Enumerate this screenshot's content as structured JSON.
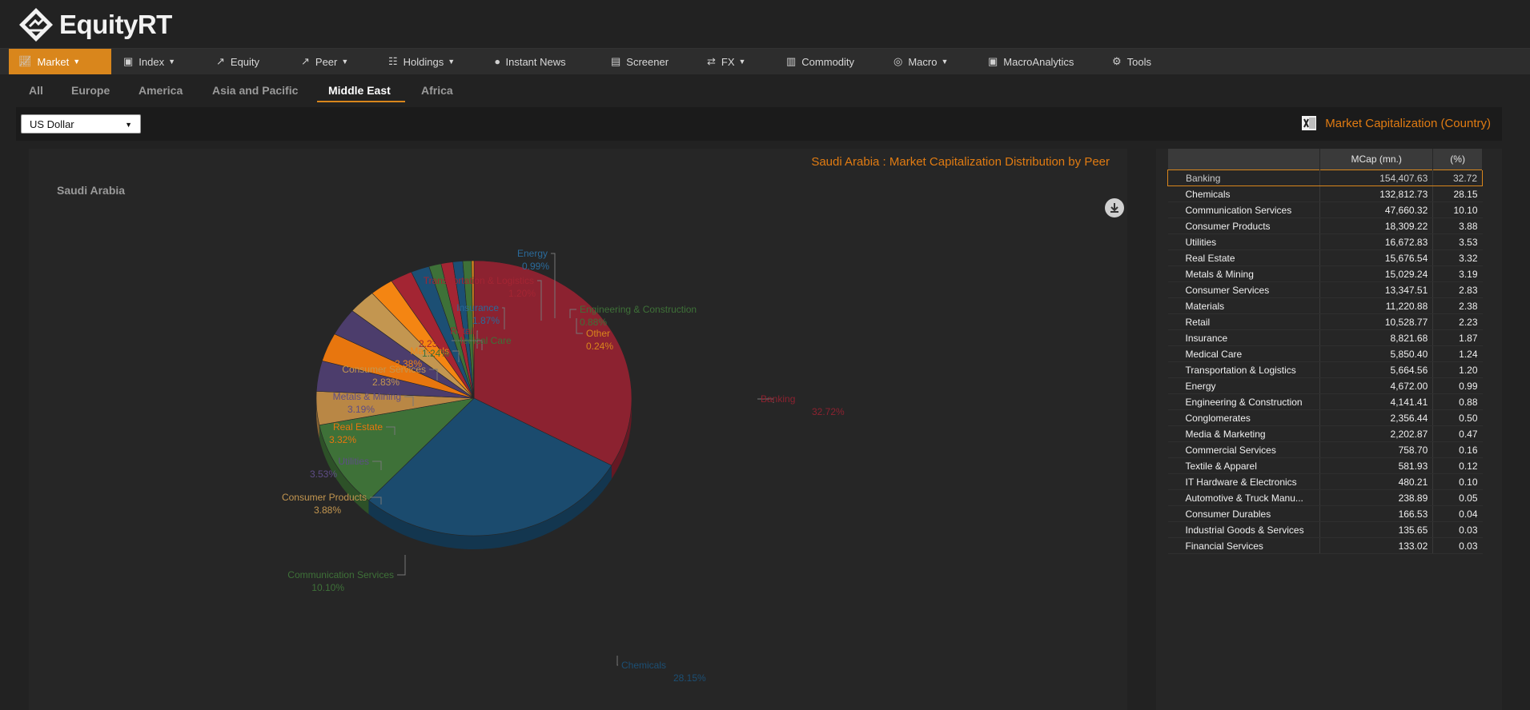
{
  "app": {
    "name": "EquityRT"
  },
  "nav": [
    {
      "label": "Market",
      "icon": "market-chart-icon",
      "dropdown": true,
      "active": true
    },
    {
      "label": "Index",
      "icon": "monitor-icon",
      "dropdown": true
    },
    {
      "label": "Equity",
      "icon": "line-chart-icon",
      "dropdown": false
    },
    {
      "label": "Peer",
      "icon": "peer-chart-icon",
      "dropdown": true
    },
    {
      "label": "Holdings",
      "icon": "holdings-icon",
      "dropdown": true
    },
    {
      "label": "Instant News",
      "icon": "news-broadcast-icon",
      "dropdown": false
    },
    {
      "label": "Screener",
      "icon": "screener-icon",
      "dropdown": false
    },
    {
      "label": "FX",
      "icon": "fx-icon",
      "dropdown": true
    },
    {
      "label": "Commodity",
      "icon": "document-icon",
      "dropdown": false
    },
    {
      "label": "Macro",
      "icon": "globe-icon",
      "dropdown": true
    },
    {
      "label": "MacroAnalytics",
      "icon": "analytics-monitor-icon",
      "dropdown": false
    },
    {
      "label": "Tools",
      "icon": "gears-icon",
      "dropdown": false
    }
  ],
  "regions": [
    {
      "label": "All",
      "active": false
    },
    {
      "label": "Europe",
      "active": false
    },
    {
      "label": "America",
      "active": false
    },
    {
      "label": "Asia and Pacific",
      "active": false
    },
    {
      "label": "Middle East",
      "active": true
    },
    {
      "label": "Africa",
      "active": false
    }
  ],
  "toolbar": {
    "currency": "US Dollar",
    "export_label": "Market Capitalization (Country)"
  },
  "chart_data": {
    "type": "pie",
    "title": "Saudi Arabia : Market Capitalization Distribution by Peer",
    "subtitle": "Saudi Arabia",
    "slices": [
      {
        "label": "Banking",
        "value": 32.72,
        "color": "#8c2230"
      },
      {
        "label": "Chemicals",
        "value": 28.15,
        "color": "#1b4b6e"
      },
      {
        "label": "Communication Services",
        "value": 10.1,
        "color": "#3e7138"
      },
      {
        "label": "Consumer Products",
        "value": 3.88,
        "color": "#b98745"
      },
      {
        "label": "Utilities",
        "value": 3.53,
        "color": "#4c3d6c"
      },
      {
        "label": "Real Estate",
        "value": 3.32,
        "color": "#e8760e"
      },
      {
        "label": "Metals & Mining",
        "value": 3.19,
        "color": "#4c3d6c"
      },
      {
        "label": "Consumer Services",
        "value": 2.83,
        "color": "#c39650"
      },
      {
        "label": "Materials",
        "value": 2.38,
        "color": "#f48512"
      },
      {
        "label": "Retail",
        "value": 2.23,
        "color": "#a32533"
      },
      {
        "label": "Insurance",
        "value": 1.87,
        "color": "#1c4f74"
      },
      {
        "label": "Medical Care",
        "value": 1.24,
        "color": "#3e7138"
      },
      {
        "label": "Transportation & Logistics",
        "value": 1.2,
        "color": "#a32533"
      },
      {
        "label": "Energy",
        "value": 0.99,
        "color": "#1c4f74"
      },
      {
        "label": "Engineering & Construction",
        "value": 0.88,
        "color": "#3e7138"
      },
      {
        "label": "Other",
        "value": 0.24,
        "color": "#d9861c"
      }
    ],
    "labels": [
      {
        "text": "Banking",
        "pct": "32.72%",
        "color": "#8c2230",
        "align": "start"
      },
      {
        "text": "Chemicals",
        "pct": "28.15%",
        "color": "#1c4f74",
        "align": "start"
      },
      {
        "text": "Communication Services",
        "pct": "10.10%",
        "color": "#3e7138",
        "align": "end"
      },
      {
        "text": "Consumer Products",
        "pct": "3.88%",
        "color": "#c39650",
        "align": "end"
      },
      {
        "text": "Utilities",
        "pct": "3.53%",
        "color": "#5e4d86",
        "align": "end"
      },
      {
        "text": "Real Estate",
        "pct": "3.32%",
        "color": "#e8760e",
        "align": "end"
      },
      {
        "text": "Metals & Mining",
        "pct": "3.19%",
        "color": "#5e4d86",
        "align": "end"
      },
      {
        "text": "Consumer Services",
        "pct": "2.83%",
        "color": "#c39650",
        "align": "end"
      },
      {
        "text": "Materials",
        "pct": "2.38%",
        "color": "#f48512",
        "align": "end"
      },
      {
        "text": "Retail",
        "pct": "2.23%",
        "color": "#a32533",
        "align": "end"
      },
      {
        "text": "Medical Care",
        "pct": "1.24%",
        "color": "#3e7138",
        "align": "start"
      },
      {
        "text": "Insurance",
        "pct": "1.87%",
        "color": "#2a6a9a",
        "align": "end"
      },
      {
        "text": "Transportation & Logistics",
        "pct": "1.20%",
        "color": "#a32533",
        "align": "end"
      },
      {
        "text": "Energy",
        "pct": "0.99%",
        "color": "#2a6a9a",
        "align": "end"
      },
      {
        "text": "Engineering & Construction",
        "pct": "0.88%",
        "color": "#3e7138",
        "align": "start"
      },
      {
        "text": "Other",
        "pct": "0.24%",
        "color": "#d9861c",
        "align": "start"
      }
    ]
  },
  "table": {
    "headers": [
      "",
      "MCap (mn.)",
      "(%)"
    ],
    "rows": [
      {
        "name": "Banking",
        "mcap": "154,407.63",
        "pct": "32.72",
        "selected": true
      },
      {
        "name": "Chemicals",
        "mcap": "132,812.73",
        "pct": "28.15"
      },
      {
        "name": "Communication Services",
        "mcap": "47,660.32",
        "pct": "10.10"
      },
      {
        "name": "Consumer Products",
        "mcap": "18,309.22",
        "pct": "3.88"
      },
      {
        "name": "Utilities",
        "mcap": "16,672.83",
        "pct": "3.53"
      },
      {
        "name": "Real Estate",
        "mcap": "15,676.54",
        "pct": "3.32"
      },
      {
        "name": "Metals & Mining",
        "mcap": "15,029.24",
        "pct": "3.19"
      },
      {
        "name": "Consumer Services",
        "mcap": "13,347.51",
        "pct": "2.83"
      },
      {
        "name": "Materials",
        "mcap": "11,220.88",
        "pct": "2.38"
      },
      {
        "name": "Retail",
        "mcap": "10,528.77",
        "pct": "2.23"
      },
      {
        "name": "Insurance",
        "mcap": "8,821.68",
        "pct": "1.87"
      },
      {
        "name": "Medical Care",
        "mcap": "5,850.40",
        "pct": "1.24"
      },
      {
        "name": "Transportation & Logistics",
        "mcap": "5,664.56",
        "pct": "1.20"
      },
      {
        "name": "Energy",
        "mcap": "4,672.00",
        "pct": "0.99"
      },
      {
        "name": "Engineering & Construction",
        "mcap": "4,141.41",
        "pct": "0.88"
      },
      {
        "name": "Conglomerates",
        "mcap": "2,356.44",
        "pct": "0.50"
      },
      {
        "name": "Media & Marketing",
        "mcap": "2,202.87",
        "pct": "0.47"
      },
      {
        "name": "Commercial Services",
        "mcap": "758.70",
        "pct": "0.16"
      },
      {
        "name": "Textile & Apparel",
        "mcap": "581.93",
        "pct": "0.12"
      },
      {
        "name": "IT Hardware & Electronics",
        "mcap": "480.21",
        "pct": "0.10"
      },
      {
        "name": "Automotive & Truck Manu...",
        "mcap": "238.89",
        "pct": "0.05"
      },
      {
        "name": "Consumer Durables",
        "mcap": "166.53",
        "pct": "0.04"
      },
      {
        "name": "Industrial Goods & Services",
        "mcap": "135.65",
        "pct": "0.03"
      },
      {
        "name": "Financial Services",
        "mcap": "133.02",
        "pct": "0.03"
      }
    ]
  }
}
